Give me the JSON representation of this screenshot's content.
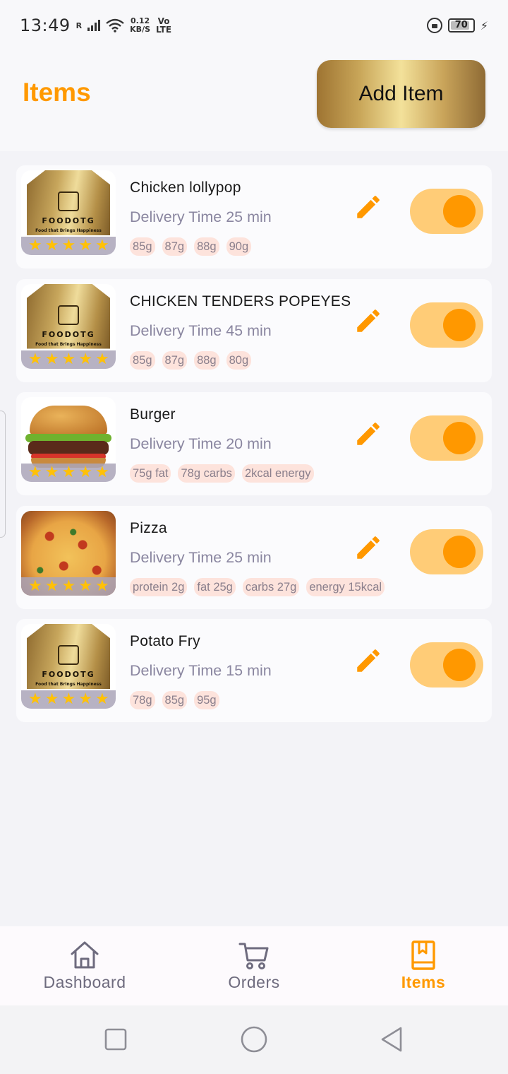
{
  "status_bar": {
    "time": "13:49",
    "signal_label": "R",
    "net_speed_value": "0.12",
    "net_speed_unit": "KB/S",
    "volte_top": "Vo",
    "volte_bottom": "LTE",
    "battery_level": "70"
  },
  "header": {
    "title": "Items",
    "add_button_label": "Add Item"
  },
  "items": [
    {
      "name": "Chicken lollypop",
      "delivery": "Delivery Time 25 min",
      "image": "foodotg-logo",
      "stars": 5,
      "enabled": true,
      "tags": [
        "85g",
        "87g",
        "88g",
        "90g"
      ]
    },
    {
      "name": "CHICKEN TENDERS POPEYES",
      "delivery": "Delivery Time 45 min",
      "image": "foodotg-logo",
      "stars": 5,
      "enabled": true,
      "tags": [
        "85g",
        "87g",
        "88g",
        "80g"
      ]
    },
    {
      "name": "Burger",
      "delivery": "Delivery Time 20 min",
      "image": "burger-photo",
      "stars": 5,
      "enabled": true,
      "tags": [
        "75g fat",
        "78g carbs",
        "2kcal energy"
      ]
    },
    {
      "name": "Pizza",
      "delivery": "Delivery Time 25 min",
      "image": "pizza-photo",
      "stars": 5,
      "enabled": true,
      "tags": [
        "protein 2g",
        "fat 25g",
        "carbs 27g",
        "energy 15kcal"
      ]
    },
    {
      "name": "Potato Fry",
      "delivery": "Delivery Time 15 min",
      "image": "foodotg-logo",
      "stars": 5,
      "enabled": true,
      "tags": [
        "78g",
        "85g",
        "95g"
      ]
    }
  ],
  "logo": {
    "name": "FOODOTG",
    "tagline": "Food that Brings Happiness"
  },
  "bottom_nav": [
    {
      "label": "Dashboard",
      "icon": "home-icon",
      "active": false
    },
    {
      "label": "Orders",
      "icon": "cart-icon",
      "active": false
    },
    {
      "label": "Items",
      "icon": "book-icon",
      "active": true
    }
  ],
  "colors": {
    "accent": "#ff9900",
    "toggle_track": "#ffcc77",
    "toggle_knob": "#ff9800",
    "tag_bg": "#fde3dc",
    "muted_text": "#8a86a0"
  },
  "system_nav": [
    "square-icon",
    "circle-icon",
    "triangle-icon"
  ]
}
